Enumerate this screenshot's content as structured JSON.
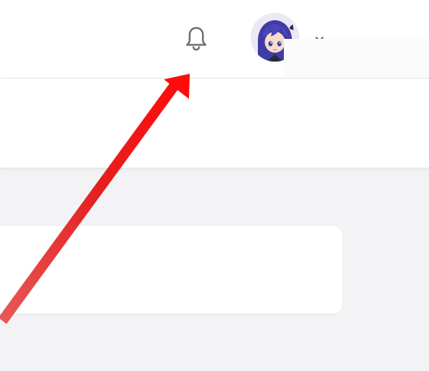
{
  "header": {
    "notifications_icon": "bell-icon",
    "user_menu_icon": "chevron-down-icon",
    "avatar_description": "user-avatar"
  },
  "annotation": {
    "arrow_color": "#e61e1e",
    "points_to": "notifications-bell"
  },
  "colors": {
    "page_bg": "#f3f3f5",
    "header_bg": "#ffffff",
    "icon_stroke": "#6b6b73"
  }
}
